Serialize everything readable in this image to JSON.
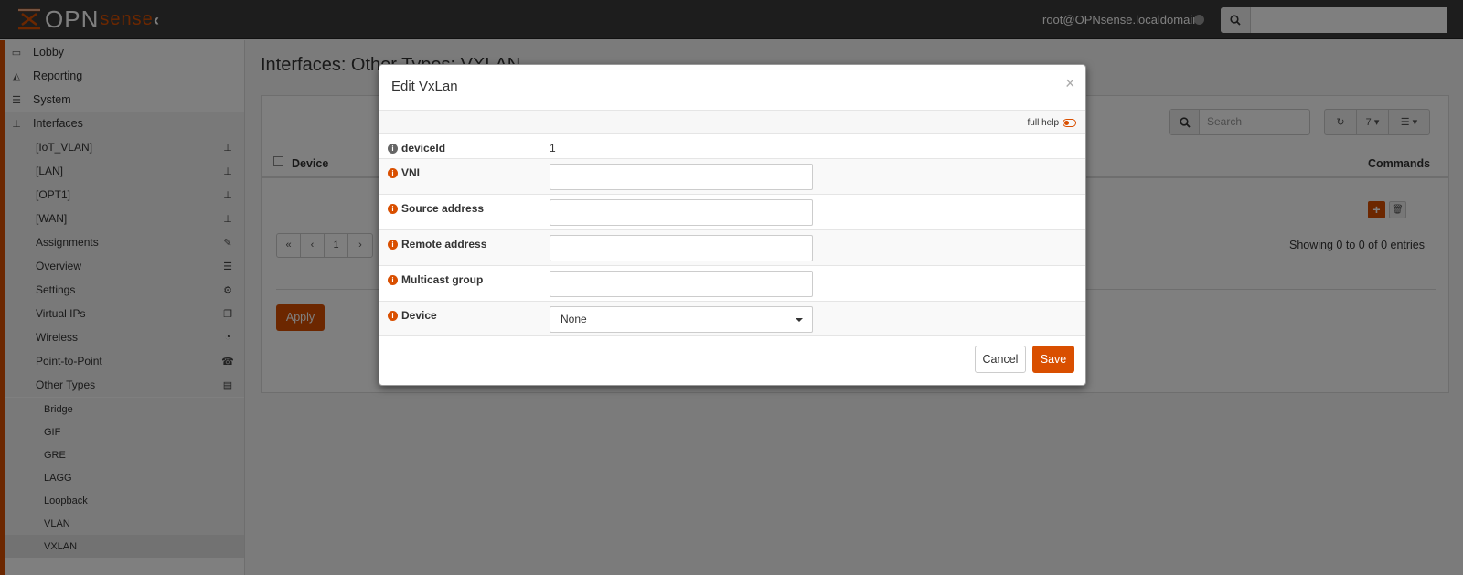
{
  "topbar": {
    "logo_text": "OPN",
    "logo_sense": "sense",
    "user": "root@OPNsense.localdomain",
    "search_placeholder": ""
  },
  "sidebar": {
    "items": [
      {
        "label": "Lobby",
        "icon": "laptop-icon"
      },
      {
        "label": "Reporting",
        "icon": "area-chart-icon"
      },
      {
        "label": "System",
        "icon": "server-icon"
      },
      {
        "label": "Interfaces",
        "icon": "sitemap-icon"
      }
    ],
    "interfaces_sub": [
      {
        "label": "[IoT_VLAN]",
        "icon": "sitemap-icon"
      },
      {
        "label": "[LAN]",
        "icon": "sitemap-icon"
      },
      {
        "label": "[OPT1]",
        "icon": "sitemap-icon"
      },
      {
        "label": "[WAN]",
        "icon": "sitemap-icon"
      },
      {
        "label": "Assignments",
        "icon": "pencil-icon"
      },
      {
        "label": "Overview",
        "icon": "tasks-icon"
      },
      {
        "label": "Settings",
        "icon": "cogs-icon"
      },
      {
        "label": "Virtual IPs",
        "icon": "clone-icon"
      },
      {
        "label": "Wireless",
        "icon": "wifi-icon"
      },
      {
        "label": "Point-to-Point",
        "icon": "tty-icon"
      },
      {
        "label": "Other Types",
        "icon": "archive-icon"
      }
    ],
    "other_types": [
      "Bridge",
      "GIF",
      "GRE",
      "LAGG",
      "Loopback",
      "VLAN",
      "VXLAN"
    ]
  },
  "main": {
    "page_title": "Interfaces: Other Types: VXLAN",
    "grid_search_placeholder": "Search",
    "page_size": "7",
    "col_device": "Device",
    "col_commands": "Commands",
    "pager": [
      "«",
      "‹",
      "1",
      "›"
    ],
    "showing": "Showing 0 to 0 of 0 entries",
    "apply_label": "Apply"
  },
  "modal": {
    "title": "Edit VxLan",
    "close": "×",
    "full_help": "full help",
    "fields": [
      {
        "label": "deviceId",
        "value": "1"
      },
      {
        "label": "VNI",
        "value": ""
      },
      {
        "label": "Source address",
        "value": ""
      },
      {
        "label": "Remote address",
        "value": ""
      },
      {
        "label": "Multicast group",
        "value": ""
      },
      {
        "label": "Device",
        "value": "None"
      }
    ],
    "cancel_label": "Cancel",
    "save_label": "Save"
  },
  "colors": {
    "accent": "#d94f00",
    "topbar": "#3a3a3a"
  }
}
